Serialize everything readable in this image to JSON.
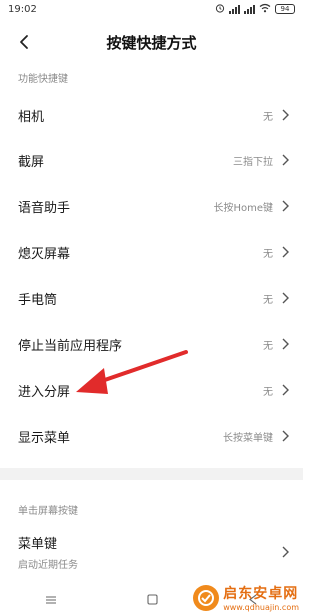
{
  "status": {
    "time": "19:02",
    "battery": "94"
  },
  "header": {
    "title": "按键快捷方式"
  },
  "sections": [
    {
      "label": "功能快捷键"
    },
    {
      "label": "单击屏幕按键"
    }
  ],
  "rows": [
    {
      "label": "相机",
      "value": "无"
    },
    {
      "label": "截屏",
      "value": "三指下拉"
    },
    {
      "label": "语音助手",
      "value": "长按Home键"
    },
    {
      "label": "熄灭屏幕",
      "value": "无"
    },
    {
      "label": "手电筒",
      "value": "无"
    },
    {
      "label": "停止当前应用程序",
      "value": "无"
    },
    {
      "label": "进入分屏",
      "value": "无"
    },
    {
      "label": "显示菜单",
      "value": "长按菜单键"
    }
  ],
  "menu_key": {
    "label": "菜单键",
    "sub": "启动近期任务"
  },
  "watermark": {
    "title": "启东安卓网",
    "url": "www.qdhuajin.com"
  },
  "colors": {
    "arrow": "#e12b2b",
    "watermark": "#e46e12"
  }
}
